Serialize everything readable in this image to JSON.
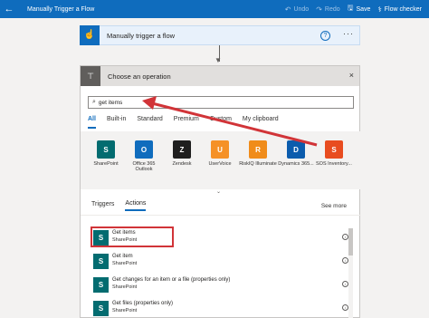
{
  "topbar": {
    "title": "Manually Trigger a Flow",
    "undo": "Undo",
    "redo": "Redo",
    "save": "Save",
    "flow_checker": "Flow checker"
  },
  "trigger": {
    "name": "Manually trigger a flow",
    "help": "?",
    "more": "···"
  },
  "panel": {
    "title": "Choose an operation",
    "close": "×",
    "search_value": "get items",
    "tabs": [
      "All",
      "Built-in",
      "Standard",
      "Premium",
      "Custom",
      "My clipboard"
    ],
    "connectors": [
      {
        "label": "SharePoint",
        "color": "#036c70",
        "glyph": "S"
      },
      {
        "label": "Office 365 Outlook",
        "color": "#0f6cbd",
        "glyph": "O"
      },
      {
        "label": "Zendesk",
        "color": "#1f1f1f",
        "glyph": "Z"
      },
      {
        "label": "UserVoice",
        "color": "#f59127",
        "glyph": "U"
      },
      {
        "label": "RiskIQ Illuminate",
        "color": "#f08c1a",
        "glyph": "R"
      },
      {
        "label": "Dynamics 365...",
        "color": "#0b5cad",
        "glyph": "D"
      },
      {
        "label": "SOS Inventory...",
        "color": "#e84c1f",
        "glyph": "S"
      }
    ],
    "subtabs": [
      "Triggers",
      "Actions"
    ],
    "see_more": "See more",
    "actions": [
      {
        "name": "Get items",
        "sub": "SharePoint"
      },
      {
        "name": "Get item",
        "sub": "SharePoint"
      },
      {
        "name": "Get changes for an item or a file (properties only)",
        "sub": "SharePoint"
      },
      {
        "name": "Get files (properties only)",
        "sub": "SharePoint"
      }
    ]
  },
  "colors": {
    "accent": "#0f6cbd",
    "annotation": "#d13438"
  }
}
